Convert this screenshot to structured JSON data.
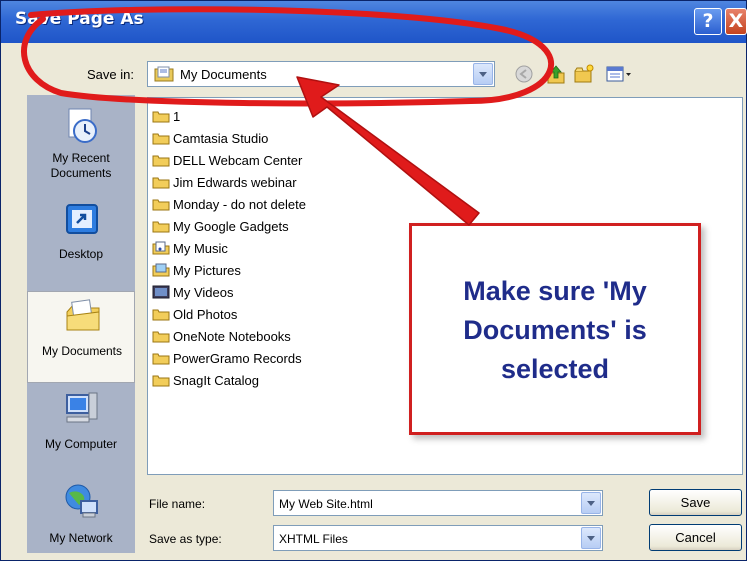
{
  "window": {
    "title": "Save Page As",
    "help_label": "?",
    "close_label": "X"
  },
  "toolbar": {
    "save_in_label": "Save in:",
    "save_in_value": "My Documents",
    "tools": [
      "back-icon",
      "up-folder-icon",
      "new-folder-icon",
      "views-menu-icon"
    ]
  },
  "places": [
    {
      "label": "My Recent Documents",
      "icon": "recent-documents-icon"
    },
    {
      "label": "Desktop",
      "icon": "desktop-icon"
    },
    {
      "label": "My Documents",
      "icon": "my-documents-icon",
      "selected": true
    },
    {
      "label": "My Computer",
      "icon": "my-computer-icon"
    },
    {
      "label": "My Network",
      "icon": "my-network-icon"
    }
  ],
  "files": [
    {
      "name": "1",
      "icon": "folder-icon"
    },
    {
      "name": "Camtasia Studio",
      "icon": "folder-icon"
    },
    {
      "name": "DELL Webcam Center",
      "icon": "folder-icon"
    },
    {
      "name": "Jim Edwards webinar",
      "icon": "folder-icon"
    },
    {
      "name": "Monday - do not delete",
      "icon": "folder-icon"
    },
    {
      "name": "My Google Gadgets",
      "icon": "folder-icon"
    },
    {
      "name": "My Music",
      "icon": "music-folder-icon"
    },
    {
      "name": "My Pictures",
      "icon": "pictures-folder-icon"
    },
    {
      "name": "My Videos",
      "icon": "videos-folder-icon"
    },
    {
      "name": "Old Photos",
      "icon": "folder-icon"
    },
    {
      "name": "OneNote Notebooks",
      "icon": "folder-icon"
    },
    {
      "name": "PowerGramo Records",
      "icon": "folder-icon"
    },
    {
      "name": "SnagIt Catalog",
      "icon": "folder-icon"
    }
  ],
  "callout": {
    "lines": [
      "Make sure 'My",
      "Documents' is",
      "selected"
    ]
  },
  "form": {
    "file_name_label": "File name:",
    "file_name_value": "My Web Site.html",
    "save_as_type_label": "Save as type:",
    "save_as_type_value": "XHTML Files"
  },
  "buttons": {
    "save": "Save",
    "cancel": "Cancel"
  },
  "colors": {
    "title_bar": "#2f67d4",
    "annotation_red": "#e01b1b",
    "callout_text": "#1f2c8a",
    "places_bar": "#a9b3c7"
  }
}
